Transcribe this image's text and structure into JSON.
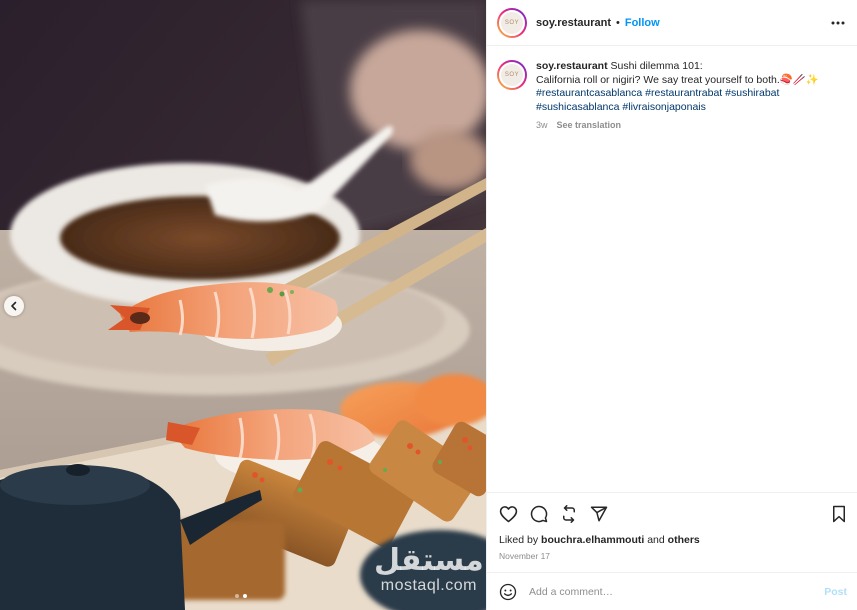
{
  "post": {
    "username": "soy.restaurant",
    "follow_label": "Follow",
    "separator": "•",
    "avatar_text": "SOY"
  },
  "caption": {
    "username": "soy.restaurant",
    "text": "Sushi dilemma 101:",
    "line2": "California roll or nigiri? We say treat yourself to both.🍣🥢✨",
    "hashtags": [
      "#restaurantcasablanca",
      "#restaurantrabat",
      "#sushirabat",
      "#sushicasablanca",
      "#livraisonjaponais"
    ],
    "time": "3w",
    "translate_label": "See translation"
  },
  "engagement": {
    "liked_prefix": "Liked by",
    "liked_user": "bouchra.elhammouti",
    "liked_and": "and",
    "liked_others": "others",
    "date": "November 17"
  },
  "comment_box": {
    "placeholder": "Add a comment…",
    "post_label": "Post"
  },
  "media": {
    "watermark_arabic": "مستقل",
    "watermark_latin": "mostaql.com",
    "carousel_count": 2,
    "carousel_active": 2
  },
  "icons": {
    "more": "more-options-icon",
    "like": "heart-icon",
    "comment": "comment-icon",
    "share": "share-icon",
    "repost": "repost-icon",
    "save": "bookmark-icon",
    "emoji": "emoji-icon",
    "prev": "chevron-left-icon"
  },
  "colors": {
    "follow": "#0095f6",
    "hashtag": "#00376b",
    "muted": "#8e8e8e",
    "post_disabled": "#b2dffc"
  }
}
